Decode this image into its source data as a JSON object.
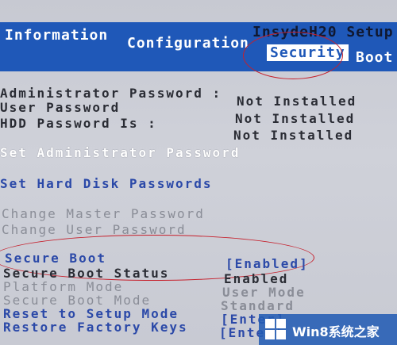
{
  "header": {
    "brand": "InsydeH20 Setup",
    "tabs": [
      {
        "label": "Information",
        "active": false
      },
      {
        "label": "Configuration",
        "active": false
      },
      {
        "label": "Security",
        "active": true
      },
      {
        "label": "Boot",
        "active": false
      }
    ]
  },
  "status": {
    "admin_password_label": "Administrator Password :",
    "admin_password_value": "Not Installed",
    "user_password_label": "User Password",
    "user_password_value": "Not Installed",
    "hdd_password_label": "HDD Password Is :",
    "hdd_password_value": "Not Installed"
  },
  "actions": {
    "set_admin_password": "Set Administrator Password",
    "set_hdd_passwords": "Set Hard Disk Passwords",
    "change_master_password": "Change Master Password",
    "change_user_password": "Change User Password"
  },
  "secure_boot": {
    "secure_boot_label": "Secure Boot",
    "secure_boot_value": "[Enabled]",
    "status_label": "Secure Boot Status",
    "status_value": "Enabled",
    "platform_mode_label": "Platform Mode",
    "platform_mode_value": "User Mode",
    "boot_mode_label": "Secure Boot Mode",
    "boot_mode_value": "Standard",
    "reset_setup_label": "Reset to Setup Mode",
    "reset_setup_value": "[Enter]",
    "restore_keys_label": "Restore Factory Keys",
    "restore_keys_value": "[Enter]"
  },
  "watermark": {
    "text": "Win8系统之家",
    "logo_icon": "windows-logo-icon"
  },
  "colors": {
    "header_bg": "#1f58b8",
    "annotation": "#c6202c",
    "selectable_text": "#2b49a8"
  }
}
